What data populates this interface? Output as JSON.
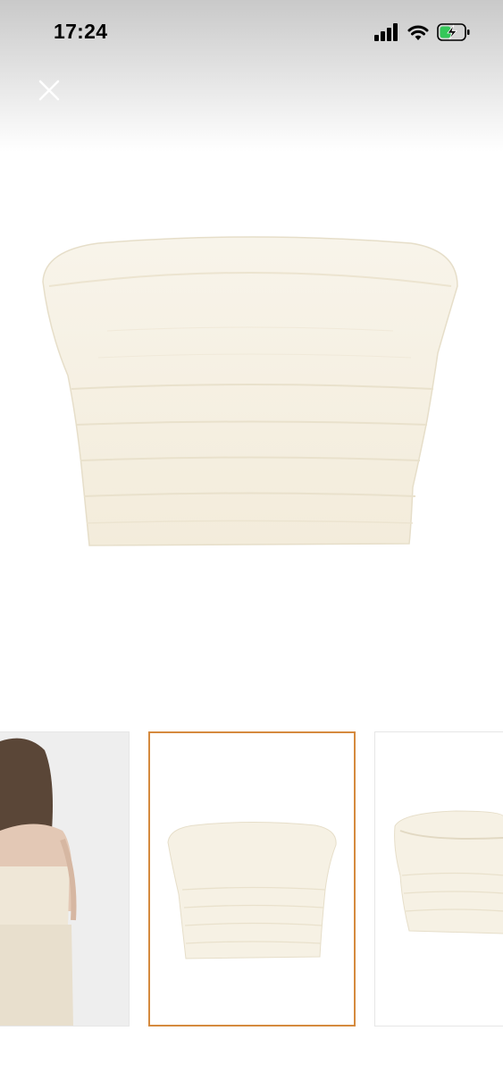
{
  "status_bar": {
    "time": "17:24",
    "icons": [
      "cellular-signal-icon",
      "wifi-icon",
      "battery-charging-icon"
    ]
  },
  "header": {
    "close_icon": "close-icon"
  },
  "gallery": {
    "selected_index": 1,
    "thumbnails": [
      {
        "subject": "model-back-view"
      },
      {
        "subject": "product-front-view"
      },
      {
        "subject": "product-angle-view"
      }
    ]
  },
  "colors": {
    "selected_border": "#d58a3e",
    "garment": "#f6f1e4",
    "garment_shadow": "#e8e0cc"
  }
}
